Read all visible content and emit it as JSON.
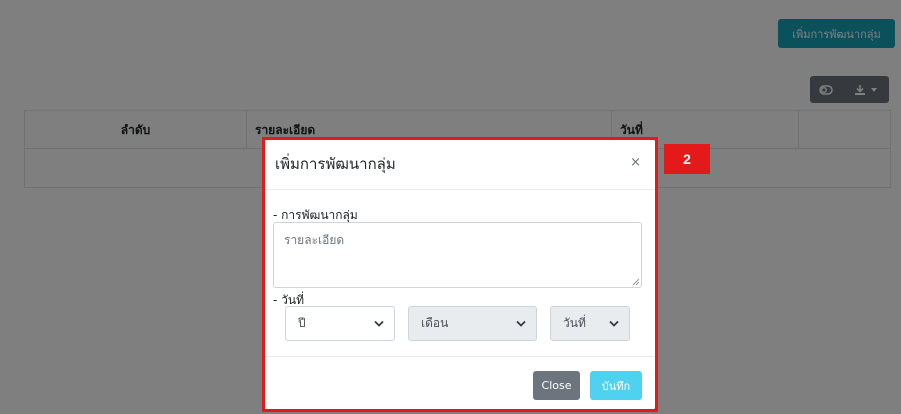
{
  "page": {
    "add_group_button": "เพิ่มการพัฒนากลุ่ม",
    "toolbar": {
      "toggle_icon": "toggle-icon",
      "export_icon": "download-icon",
      "caret_icon": "caret-down-icon"
    }
  },
  "table": {
    "columns": [
      "ลำดับ",
      "รายละเอียด",
      "วันที่",
      ""
    ]
  },
  "modal": {
    "title": "เพิ่มการพัฒนากลุ่ม",
    "close_symbol": "×",
    "section_development_label": "- การพัฒนากลุ่ม",
    "description_placeholder": "รายละเอียด",
    "section_date_label": "- วันที่",
    "year_select": "ปี",
    "month_select": "เดือน",
    "day_select": "วันที่",
    "close_button": "Close",
    "save_button": "บันทึก"
  },
  "annotation": {
    "step_number": "2",
    "highlight_color": "#e41a1a"
  },
  "colors": {
    "info": "#17a2b8",
    "secondary": "#6c757d",
    "save": "#4fd1f0"
  }
}
